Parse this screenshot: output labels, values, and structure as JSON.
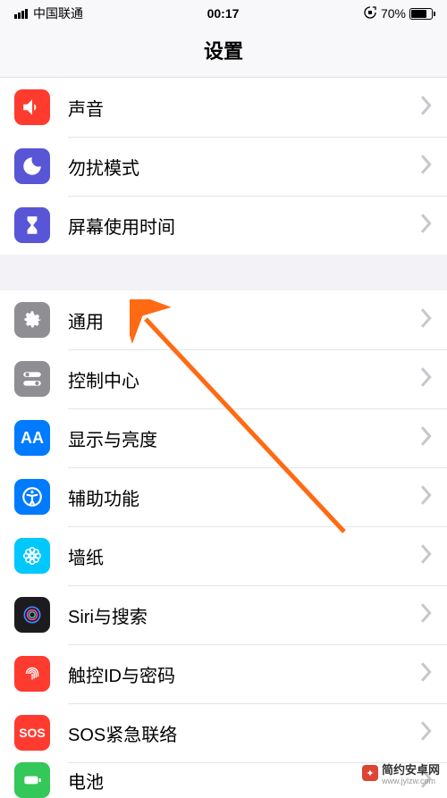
{
  "status": {
    "carrier": "中国联通",
    "time": "00:17",
    "battery": "70%"
  },
  "header": {
    "title": "设置"
  },
  "sections": [
    {
      "items": [
        {
          "id": "sounds",
          "label": "声音",
          "iconBg": "#ff3b30"
        },
        {
          "id": "dnd",
          "label": "勿扰模式",
          "iconBg": "#5856d6"
        },
        {
          "id": "screentime",
          "label": "屏幕使用时间",
          "iconBg": "#5856d6"
        }
      ]
    },
    {
      "items": [
        {
          "id": "general",
          "label": "通用",
          "iconBg": "#8e8e93"
        },
        {
          "id": "control-center",
          "label": "控制中心",
          "iconBg": "#8e8e93"
        },
        {
          "id": "display",
          "label": "显示与亮度",
          "iconBg": "#007aff"
        },
        {
          "id": "accessibility",
          "label": "辅助功能",
          "iconBg": "#007aff"
        },
        {
          "id": "wallpaper",
          "label": "墙纸",
          "iconBg": "#00c7fc"
        },
        {
          "id": "siri",
          "label": "Siri与搜索",
          "iconBg": "#1c1c1e"
        },
        {
          "id": "touchid",
          "label": "触控ID与密码",
          "iconBg": "#ff3b30"
        },
        {
          "id": "sos",
          "label": "SOS紧急联络",
          "iconBg": "#ff3b30",
          "textIcon": "SOS"
        },
        {
          "id": "battery",
          "label": "电池",
          "iconBg": "#34c759"
        }
      ]
    }
  ],
  "watermark": {
    "text": "简约安卓网",
    "url": "www.jylzw.com"
  }
}
